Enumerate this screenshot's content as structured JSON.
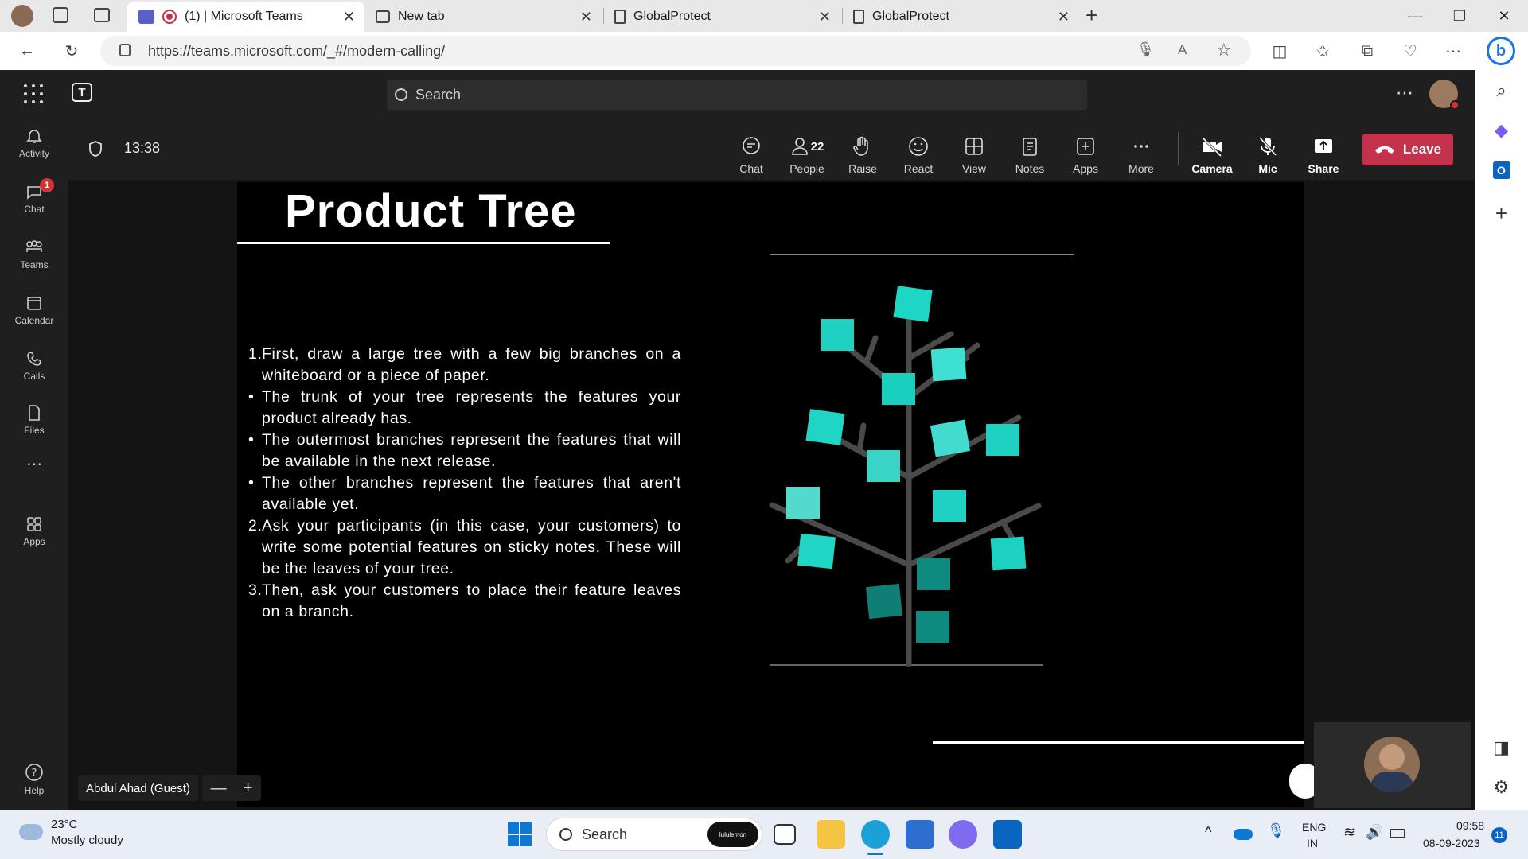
{
  "browser": {
    "tabs": [
      {
        "title": "(1) | Microsoft Teams",
        "active": true
      },
      {
        "title": "New tab",
        "active": false
      },
      {
        "title": "GlobalProtect",
        "active": false
      },
      {
        "title": "GlobalProtect",
        "active": false
      }
    ],
    "url": "https://teams.microsoft.com/_#/modern-calling/"
  },
  "teams": {
    "search_placeholder": "Search",
    "rail": [
      {
        "label": "Activity",
        "icon": "bell-icon"
      },
      {
        "label": "Chat",
        "icon": "chat-icon",
        "badge": "1"
      },
      {
        "label": "Teams",
        "icon": "teams-icon"
      },
      {
        "label": "Calendar",
        "icon": "calendar-icon"
      },
      {
        "label": "Calls",
        "icon": "phone-icon"
      },
      {
        "label": "Files",
        "icon": "file-icon"
      },
      {
        "label": "Apps",
        "icon": "apps-icon"
      },
      {
        "label": "Help",
        "icon": "help-icon"
      }
    ],
    "meeting": {
      "timer": "13:38",
      "people_count": "22",
      "controls": [
        "Chat",
        "People",
        "Raise",
        "React",
        "View",
        "Notes",
        "Apps",
        "More",
        "Camera",
        "Mic",
        "Share"
      ],
      "leave_label": "Leave",
      "participant_name": "Abdul Ahad (Guest)"
    }
  },
  "slide": {
    "title": "Product Tree",
    "items": [
      {
        "marker": "1.",
        "text": "First, draw a large tree with a few big branches on a whiteboard or a piece of paper."
      },
      {
        "marker": "•",
        "text": "The trunk of your tree represents the features your product already has."
      },
      {
        "marker": "•",
        "text": "The outermost branches represent the features that will be available in the next release."
      },
      {
        "marker": "•",
        "text": "The other branches represent the features that aren't available yet."
      },
      {
        "marker": "2.",
        "text": "Ask your participants (in this case, your customers) to write some potential features on sticky notes. These will be the leaves of your tree."
      },
      {
        "marker": "3.",
        "text": "Then, ask your customers to place their feature leaves on a branch."
      }
    ]
  },
  "taskbar": {
    "weather_temp": "23°C",
    "weather_desc": "Mostly cloudy",
    "search_placeholder": "Search",
    "search_badge": "lululemon",
    "lang_top": "ENG",
    "lang_bottom": "IN",
    "time": "09:58",
    "date": "08-09-2023",
    "notif_count": "11"
  },
  "colors": {
    "leave": "#c4314b",
    "teal_note": "#1fd1c1",
    "dark_note": "#0f8a80",
    "badge": "#d13438"
  }
}
